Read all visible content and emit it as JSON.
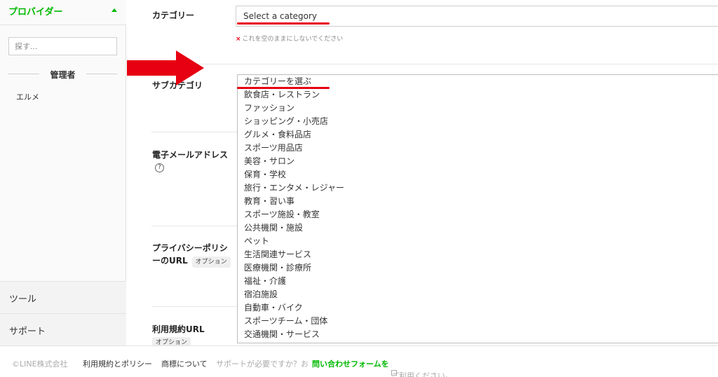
{
  "sidebar": {
    "provider_title": "プロバイダー",
    "search_placeholder": "探す...",
    "admin_label": "管理者",
    "account_item": "エルメ",
    "tools_label": "ツール",
    "support_label": "サポート"
  },
  "form": {
    "category_label": "カテゴリー",
    "category_select_value": "Select a category",
    "category_error": "これを空のままにしないでください",
    "subcategory_label": "サブカテゴリ",
    "email_label": "電子メールアドレス",
    "privacy_label_line1": "プライバシーポリシ",
    "privacy_label_line2": "ーのURL",
    "privacy_optional": "オプション",
    "terms_label": "利用規約URL",
    "terms_optional": "オプション"
  },
  "dropdown": {
    "options": [
      "カテゴリーを選ぶ",
      "飲食店・レストラン",
      "ファッション",
      "ショッピング・小売店",
      "グルメ・食料品店",
      "スポーツ用品店",
      "美容・サロン",
      "保育・学校",
      "旅行・エンタメ・レジャー",
      "教育・習い事",
      "スポーツ施設・教室",
      "公共機関・施設",
      "ペット",
      "生活関連サービス",
      "医療機関・診療所",
      "福祉・介護",
      "宿泊施設",
      "自動車・バイク",
      "スポーツチーム・団体",
      "交通機関・サービス"
    ]
  },
  "footer": {
    "copyright": "©LINE株式会社",
    "terms_link": "利用規約とポリシー",
    "trademark_link": "商標について",
    "support_prefix": "サポートが必要ですか？お",
    "contact_link": "問い合わせフォームを",
    "support_suffix": "ご利用ください。"
  },
  "colors": {
    "brand_green": "#00b900",
    "annotation_red": "#e60012"
  }
}
